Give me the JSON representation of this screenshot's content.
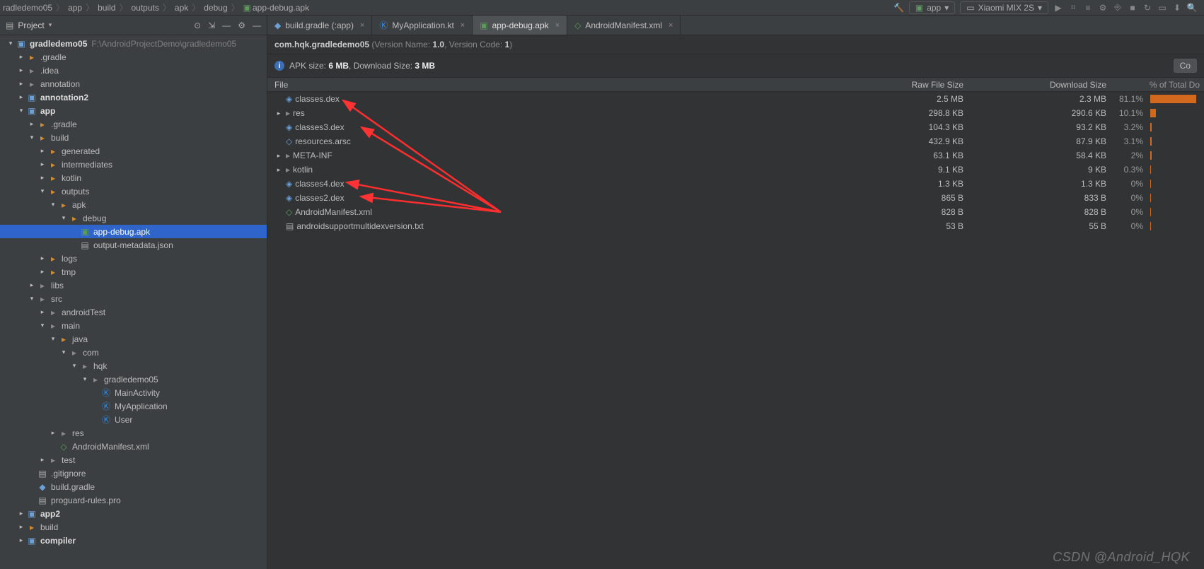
{
  "breadcrumbs": [
    "radledemo05",
    "app",
    "build",
    "outputs",
    "apk",
    "debug",
    "app-debug.apk"
  ],
  "toolbar": {
    "run_config": "app",
    "device": "Xiaomi MIX 2S"
  },
  "project_panel": {
    "title": "Project",
    "root_name": "gradledemo05",
    "root_path": "F:\\AndroidProjectDemo\\gradledemo05",
    "tree": [
      {
        "d": 0,
        "label": "gradledemo05",
        "icon": "mod",
        "arrow": "v",
        "bold": true,
        "hint": "F:\\AndroidProjectDemo\\gradledemo05"
      },
      {
        "d": 1,
        "label": ".gradle",
        "icon": "fold-c",
        "arrow": ">"
      },
      {
        "d": 1,
        "label": ".idea",
        "icon": "fold-g",
        "arrow": ">"
      },
      {
        "d": 1,
        "label": "annotation",
        "icon": "fold-g",
        "arrow": ">"
      },
      {
        "d": 1,
        "label": "annotation2",
        "icon": "mod",
        "arrow": ">",
        "bold": true
      },
      {
        "d": 1,
        "label": "app",
        "icon": "mod",
        "arrow": "v",
        "bold": true
      },
      {
        "d": 2,
        "label": ".gradle",
        "icon": "fold-c",
        "arrow": ">"
      },
      {
        "d": 2,
        "label": "build",
        "icon": "fold-c",
        "arrow": "v"
      },
      {
        "d": 3,
        "label": "generated",
        "icon": "fold-c",
        "arrow": ">"
      },
      {
        "d": 3,
        "label": "intermediates",
        "icon": "fold-c",
        "arrow": ">"
      },
      {
        "d": 3,
        "label": "kotlin",
        "icon": "fold-c",
        "arrow": ">"
      },
      {
        "d": 3,
        "label": "outputs",
        "icon": "fold-c",
        "arrow": "v"
      },
      {
        "d": 4,
        "label": "apk",
        "icon": "fold-c",
        "arrow": "v"
      },
      {
        "d": 5,
        "label": "debug",
        "icon": "fold-c",
        "arrow": "v"
      },
      {
        "d": 6,
        "label": "app-debug.apk",
        "icon": "apk",
        "arrow": "",
        "selected": true
      },
      {
        "d": 6,
        "label": "output-metadata.json",
        "icon": "txt",
        "arrow": ""
      },
      {
        "d": 3,
        "label": "logs",
        "icon": "fold-c",
        "arrow": ">"
      },
      {
        "d": 3,
        "label": "tmp",
        "icon": "fold-c",
        "arrow": ">"
      },
      {
        "d": 2,
        "label": "libs",
        "icon": "fold-g",
        "arrow": ">"
      },
      {
        "d": 2,
        "label": "src",
        "icon": "fold-g",
        "arrow": "v"
      },
      {
        "d": 3,
        "label": "androidTest",
        "icon": "fold-g",
        "arrow": ">"
      },
      {
        "d": 3,
        "label": "main",
        "icon": "fold-g",
        "arrow": "v"
      },
      {
        "d": 4,
        "label": "java",
        "icon": "fold-c",
        "arrow": "v"
      },
      {
        "d": 5,
        "label": "com",
        "icon": "fold-g",
        "arrow": "v"
      },
      {
        "d": 6,
        "label": "hqk",
        "icon": "fold-g",
        "arrow": "v"
      },
      {
        "d": 7,
        "label": "gradledemo05",
        "icon": "fold-g",
        "arrow": "v"
      },
      {
        "d": 8,
        "label": "MainActivity",
        "icon": "kt",
        "arrow": ""
      },
      {
        "d": 8,
        "label": "MyApplication",
        "icon": "kt",
        "arrow": ""
      },
      {
        "d": 8,
        "label": "User",
        "icon": "kt",
        "arrow": ""
      },
      {
        "d": 4,
        "label": "res",
        "icon": "fold-g",
        "arrow": ">"
      },
      {
        "d": 4,
        "label": "AndroidManifest.xml",
        "icon": "xml",
        "arrow": ""
      },
      {
        "d": 3,
        "label": "test",
        "icon": "fold-g",
        "arrow": ">"
      },
      {
        "d": 2,
        "label": ".gitignore",
        "icon": "txt",
        "arrow": ""
      },
      {
        "d": 2,
        "label": "build.gradle",
        "icon": "gradle",
        "arrow": ""
      },
      {
        "d": 2,
        "label": "proguard-rules.pro",
        "icon": "txt",
        "arrow": ""
      },
      {
        "d": 1,
        "label": "app2",
        "icon": "mod",
        "arrow": ">",
        "bold": true
      },
      {
        "d": 1,
        "label": "build",
        "icon": "fold-c",
        "arrow": ">"
      },
      {
        "d": 1,
        "label": "compiler",
        "icon": "mod",
        "arrow": ">",
        "bold": true
      }
    ]
  },
  "tabs": [
    {
      "label": "build.gradle (:app)",
      "icon": "gradle",
      "active": false
    },
    {
      "label": "MyApplication.kt",
      "icon": "kt",
      "active": false
    },
    {
      "label": "app-debug.apk",
      "icon": "apk",
      "active": true
    },
    {
      "label": "AndroidManifest.xml",
      "icon": "xml",
      "active": false
    }
  ],
  "apk_info": {
    "package_line_prefix": "com.hqk.gradledemo05",
    "version_name_label": " (Version Name: ",
    "version_name": "1.0",
    "version_code_label": ", Version Code: ",
    "version_code": "1",
    "suffix": ")",
    "size_prefix": "APK size: ",
    "size": "6 MB",
    "dl_prefix": ", Download Size: ",
    "dl_size": "3 MB",
    "compare_label": "Co"
  },
  "table": {
    "headers": {
      "file": "File",
      "raw": "Raw File Size",
      "dl": "Download Size",
      "pct": "% of Total Do"
    },
    "rows": [
      {
        "name": "classes.dex",
        "icon": "dex",
        "arrow": "",
        "raw": "2.5 MB",
        "dl": "2.3 MB",
        "pct": "81.1%",
        "bar": 81
      },
      {
        "name": "res",
        "icon": "fold",
        "arrow": ">",
        "raw": "298.8 KB",
        "dl": "290.6 KB",
        "pct": "10.1%",
        "bar": 10
      },
      {
        "name": "classes3.dex",
        "icon": "dex",
        "arrow": "",
        "raw": "104.3 KB",
        "dl": "93.2 KB",
        "pct": "3.2%",
        "bar": 3
      },
      {
        "name": "resources.arsc",
        "icon": "arsc",
        "arrow": "",
        "raw": "432.9 KB",
        "dl": "87.9 KB",
        "pct": "3.1%",
        "bar": 3
      },
      {
        "name": "META-INF",
        "icon": "fold",
        "arrow": ">",
        "raw": "63.1 KB",
        "dl": "58.4 KB",
        "pct": "2%",
        "bar": 2
      },
      {
        "name": "kotlin",
        "icon": "fold",
        "arrow": ">",
        "raw": "9.1 KB",
        "dl": "9 KB",
        "pct": "0.3%",
        "bar": 0.5
      },
      {
        "name": "classes4.dex",
        "icon": "dex",
        "arrow": "",
        "raw": "1.3 KB",
        "dl": "1.3 KB",
        "pct": "0%",
        "bar": 0
      },
      {
        "name": "classes2.dex",
        "icon": "dex",
        "arrow": "",
        "raw": "865 B",
        "dl": "833 B",
        "pct": "0%",
        "bar": 0
      },
      {
        "name": "AndroidManifest.xml",
        "icon": "xml",
        "arrow": "",
        "raw": "828 B",
        "dl": "828 B",
        "pct": "0%",
        "bar": 0
      },
      {
        "name": "androidsupportmultidexversion.txt",
        "icon": "txt",
        "arrow": "",
        "raw": "53 B",
        "dl": "55 B",
        "pct": "0%",
        "bar": 0
      }
    ]
  },
  "watermark": "CSDN @Android_HQK"
}
